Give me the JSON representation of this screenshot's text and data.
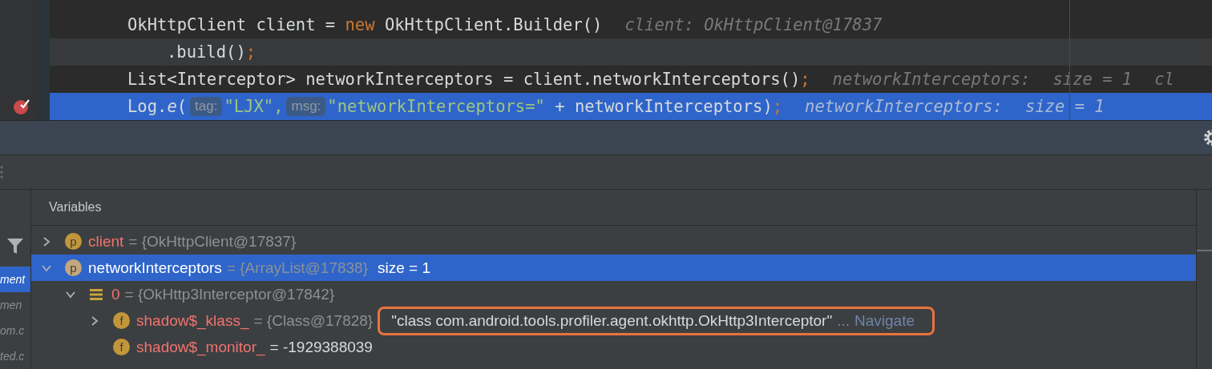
{
  "editor": {
    "lines": [
      {
        "selected": false,
        "caret_line": false,
        "continuation": false,
        "breakpoint": false,
        "tokens": [
          {
            "kind": "plain",
            "text": "OkHttpClient client = "
          },
          {
            "kind": "keyword",
            "text": "new"
          },
          {
            "kind": "plain",
            "text": " OkHttpClient.Builder()"
          },
          {
            "kind": "inline",
            "text": "client: OkHttpClient@17837"
          }
        ]
      },
      {
        "selected": false,
        "caret_line": true,
        "continuation": true,
        "breakpoint": false,
        "tokens": [
          {
            "kind": "plain",
            "text": ".build()"
          },
          {
            "kind": "keyword",
            "text": ";"
          }
        ]
      },
      {
        "selected": false,
        "caret_line": false,
        "continuation": false,
        "breakpoint": false,
        "tokens": [
          {
            "kind": "plain",
            "text": "List<Interceptor> networkInterceptors = client.networkInterceptors()"
          },
          {
            "kind": "keyword",
            "text": ";"
          },
          {
            "kind": "inline",
            "text": "networkInterceptors:"
          },
          {
            "kind": "inline",
            "text": "size = 1"
          },
          {
            "kind": "inline",
            "text": "cl"
          }
        ]
      },
      {
        "selected": true,
        "caret_line": false,
        "continuation": false,
        "breakpoint": true,
        "tokens": [
          {
            "kind": "plain",
            "text": "Log."
          },
          {
            "kind": "italic",
            "text": "e"
          },
          {
            "kind": "plain",
            "text": "("
          },
          {
            "kind": "hint",
            "text": "tag:"
          },
          {
            "kind": "string",
            "text": "\"LJX\","
          },
          {
            "kind": "hint",
            "text": "msg:"
          },
          {
            "kind": "string",
            "text": "\"networkInterceptors=\""
          },
          {
            "kind": "plain",
            "text": " + networkInterceptors)"
          },
          {
            "kind": "keyword",
            "text": ";"
          },
          {
            "kind": "inline",
            "text": "networkInterceptors:"
          },
          {
            "kind": "inline",
            "text": "size = 1"
          }
        ]
      }
    ]
  },
  "frames": [
    {
      "text": "ment",
      "selected": true
    },
    {
      "text": "men",
      "selected": false
    },
    {
      "text": "om.c",
      "selected": false
    },
    {
      "text": "ted.c",
      "selected": false
    }
  ],
  "variables": {
    "title": "Variables",
    "items": [
      {
        "kind": "property",
        "badge": "p",
        "name": "client",
        "equals": "=",
        "value": "{OkHttpClient@17837}",
        "expanded": false,
        "selected": false
      },
      {
        "kind": "property",
        "badge": "p",
        "name": "networkInterceptors",
        "equals": "=",
        "value": "{ArrayList@17838}",
        "extra": "size = 1",
        "expanded": true,
        "selected": true,
        "children": [
          {
            "kind": "element",
            "name": "0",
            "equals": "=",
            "value": "{OkHttp3Interceptor@17842}",
            "expanded": true,
            "selected": false,
            "children": [
              {
                "kind": "field",
                "badge": "f",
                "name": "shadow$_klass_",
                "equals": "=",
                "value": "{Class@17828}",
                "expanded": false,
                "selected": false,
                "string_value": "\"class com.android.tools.profiler.agent.okhttp.OkHttp3Interceptor\"",
                "ellipsis": "...",
                "link": "Navigate",
                "highlighted": true
              },
              {
                "kind": "field_number",
                "badge": "f",
                "name": "shadow$_monitor_",
                "equals": "=",
                "value": "-1929388039",
                "selected": false
              }
            ]
          }
        ]
      }
    ]
  }
}
